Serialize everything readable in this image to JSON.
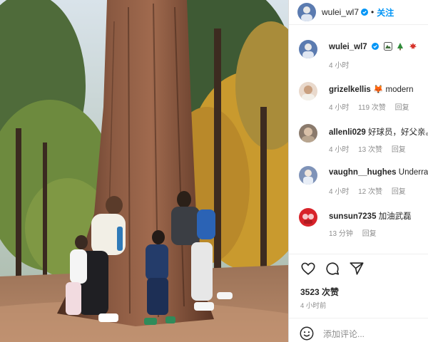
{
  "header": {
    "username": "wulei_wl7",
    "separator": "•",
    "follow_label": "关注"
  },
  "caption": {
    "username": "wulei_wl7",
    "emoji_icons": [
      "mountain-icon",
      "tree-icon",
      "maple-leaf-icon"
    ],
    "time": "4 小时"
  },
  "comments": [
    {
      "username": "grizelkellis",
      "text": "🦊 modern",
      "time": "4 小时",
      "likes": "119 次赞",
      "reply": "回复"
    },
    {
      "username": "allenli029",
      "text": "好球员，好父亲。",
      "time": "4 小时",
      "likes": "13 次赞",
      "reply": "回复"
    },
    {
      "username": "vaughn__hughes",
      "text": "Underrat",
      "time": "4 小时",
      "likes": "12 次赞",
      "reply": "回复"
    },
    {
      "username": "sunsun7235",
      "text": "加油武磊",
      "time": "13 分钟",
      "likes": "",
      "reply": "回复"
    }
  ],
  "post": {
    "likes": "3523 次赞",
    "time": "4 小时前",
    "add_comment_placeholder": "添加评论..."
  },
  "colors": {
    "accent": "#0095f6",
    "text": "#262626",
    "muted": "#8e8e8e",
    "divider": "#efefef"
  }
}
